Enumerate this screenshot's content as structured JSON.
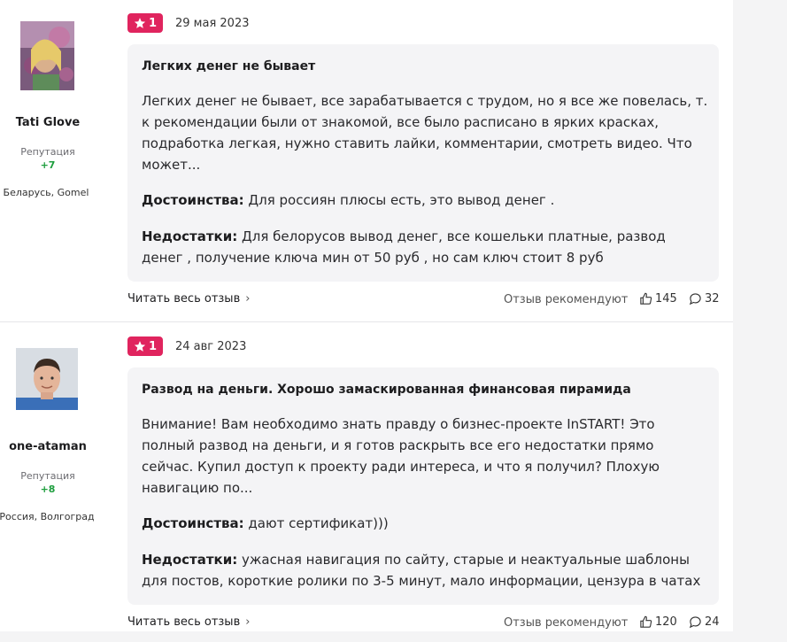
{
  "reviews": [
    {
      "author": {
        "name": "Tati Glove",
        "reputation_label": "Репутация",
        "reputation_value": "+7",
        "location": "Беларусь, Gomel"
      },
      "rating": "1",
      "date": "29 мая 2023",
      "title": "Легких денег не бывает",
      "body": "Легких денег не бывает, все зарабатывается с трудом, но я все же повелась, т. к рекомендации были от знакомой, все было расписано в ярких красках, подработка легкая, нужно ставить лайки, комментарии, смотреть видео. Что может...",
      "pros_label": "Достоинства:",
      "pros": "Для россиян плюсы есть, это вывод денег .",
      "cons_label": "Недостатки:",
      "cons": "Для белорусов вывод денег, все кошельки платные, развод денег , получение ключа мин от 50 руб , но сам ключ стоит 8 руб",
      "read_more": "Читать весь отзыв",
      "recommend_label": "Отзыв рекомендуют",
      "likes": "145",
      "comments": "32"
    },
    {
      "author": {
        "name": "one-ataman",
        "reputation_label": "Репутация",
        "reputation_value": "+8",
        "location": "Россия, Волгоград"
      },
      "rating": "1",
      "date": "24 авг 2023",
      "title": "Развод на деньги. Хорошо замаскированная финансовая пирамида",
      "body": "Внимание! Вам необходимо знать правду о бизнес-проекте InSTART! Это полный развод на деньги, и я готов раскрыть все его недостатки прямо сейчас. Купил доступ к проекту ради интереса, и что я получил? Плохую навигацию по...",
      "pros_label": "Достоинства:",
      "pros": "дают сертификат)))",
      "cons_label": "Недостатки:",
      "cons": "ужасная навигация по сайту, старые и неактуальные шаблоны для постов, короткие ролики по 3-5 минут, мало информации, цензура в чатах",
      "read_more": "Читать весь отзыв",
      "recommend_label": "Отзыв рекомендуют",
      "likes": "120",
      "comments": "24"
    }
  ],
  "icons": {
    "star": "star-icon",
    "like": "thumb-up-icon",
    "comment": "comment-icon",
    "chevron": "chevron-right-icon"
  },
  "colors": {
    "rating_badge": "#e0245e",
    "reputation": "#1e9e3e",
    "card_bg": "#f4f4f6"
  }
}
